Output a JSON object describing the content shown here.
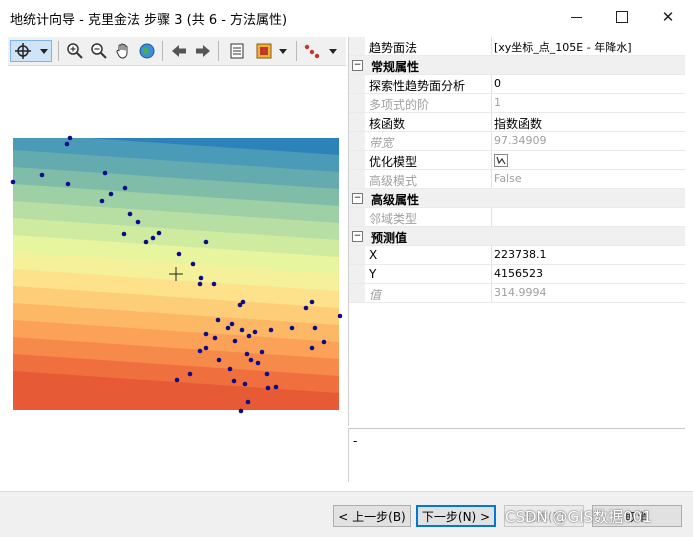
{
  "window": {
    "title": "地统计向导 - 克里金法 步骤 3 (共 6 - 方法属性)"
  },
  "toolbar": {
    "icons": [
      "pan-cursor-icon",
      "dropdown-icon",
      "zoom-in-icon",
      "zoom-out-icon",
      "hand-icon",
      "globe-icon",
      "back-arrow-icon",
      "forward-arrow-icon",
      "table-icon",
      "layer-icon",
      "points-icon"
    ]
  },
  "properties": {
    "top": {
      "name": "趋势面法",
      "value": "[xy坐标_点_105E - 年降水]"
    },
    "groups": [
      {
        "title": "常规属性",
        "rows": [
          {
            "name": "探索性趋势面分析",
            "value": "0",
            "state": "normal"
          },
          {
            "name": "多项式的阶",
            "value": "1",
            "state": "disabled"
          },
          {
            "name": "核函数",
            "value": "指数函数",
            "state": "normal"
          },
          {
            "name": "带宽",
            "value": "97.34909",
            "state": "disabled-italic"
          },
          {
            "name": "优化模型",
            "value": "",
            "state": "normal"
          },
          {
            "name": "高级模式",
            "value": "False",
            "state": "disabled"
          }
        ]
      },
      {
        "title": "高级属性",
        "rows": [
          {
            "name": "邻域类型",
            "value": "",
            "state": "disabled"
          }
        ]
      },
      {
        "title": "预测值",
        "rows": [
          {
            "name": "X",
            "value": "223738.1",
            "state": "normal"
          },
          {
            "name": "Y",
            "value": "4156523",
            "state": "normal"
          },
          {
            "name": "值",
            "value": "314.9994",
            "state": "disabled-italic"
          }
        ]
      }
    ]
  },
  "description": {
    "text": "-"
  },
  "buttons": {
    "back": "< 上一步(B)",
    "next": "下一步(N) >",
    "finish": "完成(F)",
    "cancel": "取消"
  },
  "watermark": "CSDN @GIS数据001",
  "map": {
    "band_colors": [
      "#2b83ba",
      "#4a9bb8",
      "#64abb0",
      "#80bda9",
      "#9dd0a4",
      "#b7dfa3",
      "#cfeba0",
      "#e6f59e",
      "#f4f19a",
      "#fde28b",
      "#fecd77",
      "#fdb866",
      "#fca258",
      "#f68a4b",
      "#ef6f3f",
      "#e65a36"
    ],
    "point_color": "#0a0a8a"
  }
}
